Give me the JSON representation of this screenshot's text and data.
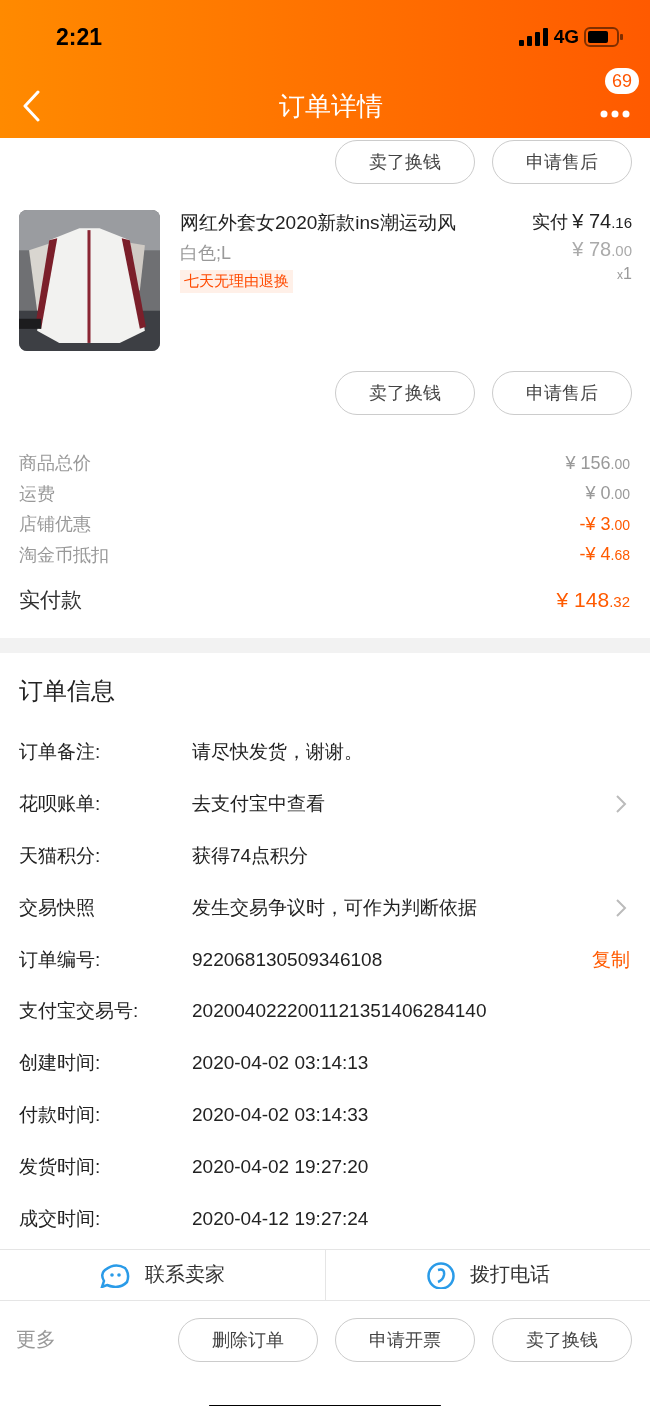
{
  "status_bar": {
    "time": "2:21",
    "network": "4G"
  },
  "nav": {
    "title": "订单详情",
    "badge": "69"
  },
  "top_actions": [
    "卖了换钱",
    "申请售后"
  ],
  "product": {
    "title": "网红外套女2020新款ins潮运动风",
    "sku": "白色;L",
    "tag": "七天无理由退换",
    "paid_label": "实付",
    "paid_amount": "¥ 74",
    "paid_cents": ".16",
    "orig_amount": "¥ 78",
    "orig_cents": ".00",
    "qty_x": "x",
    "qty": "1"
  },
  "product_actions": [
    "卖了换钱",
    "申请售后"
  ],
  "price_rows": [
    {
      "label": "商品总价",
      "amount": "¥ 156",
      "cents": ".00",
      "highlight": false
    },
    {
      "label": "运费",
      "amount": "¥ 0",
      "cents": ".00",
      "highlight": false
    },
    {
      "label": "店铺优惠",
      "amount": "-¥ 3",
      "cents": ".00",
      "highlight": true
    },
    {
      "label": "淘金币抵扣",
      "amount": "-¥ 4",
      "cents": ".68",
      "highlight": true
    }
  ],
  "total": {
    "label": "实付款",
    "amount": "¥ 148",
    "cents": ".32"
  },
  "order_info": {
    "title": "订单信息",
    "rows": [
      {
        "label": "订单备注:",
        "value": "请尽快发货，谢谢。",
        "kind": "plain"
      },
      {
        "label": "花呗账单:",
        "value": "去支付宝中查看",
        "kind": "link"
      },
      {
        "label": "天猫积分:",
        "value": "获得74点积分",
        "kind": "plain"
      },
      {
        "label": "交易快照",
        "value": "发生交易争议时，可作为判断依据",
        "kind": "link"
      },
      {
        "label": "订单编号:",
        "value": "922068130509346108",
        "kind": "copy",
        "action": "复制"
      },
      {
        "label": "支付宝交易号:",
        "value": "2020040222001121351406284140",
        "kind": "plain"
      },
      {
        "label": "创建时间:",
        "value": "2020-04-02 03:14:13",
        "kind": "plain"
      },
      {
        "label": "付款时间:",
        "value": "2020-04-02 03:14:33",
        "kind": "plain"
      },
      {
        "label": "发货时间:",
        "value": "2020-04-02 19:27:20",
        "kind": "plain"
      },
      {
        "label": "成交时间:",
        "value": "2020-04-12 19:27:24",
        "kind": "plain"
      }
    ]
  },
  "contact": [
    {
      "label": "联系卖家",
      "kind": "chat"
    },
    {
      "label": "拨打电话",
      "kind": "phone"
    }
  ],
  "bottom_bar": {
    "more": "更多",
    "buttons": [
      "删除订单",
      "申请开票",
      "卖了换钱"
    ]
  }
}
